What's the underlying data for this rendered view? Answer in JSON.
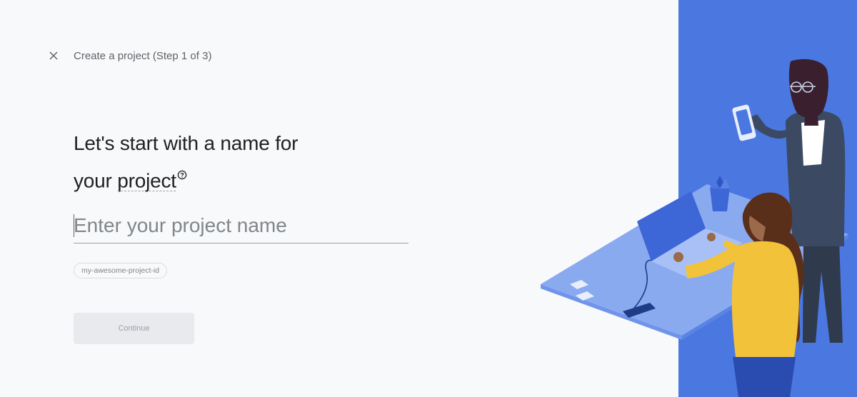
{
  "header": {
    "title": "Create a project (Step 1 of 3)",
    "close_icon": "close-icon"
  },
  "headline": {
    "line1": "Let's start with a name for",
    "line2_prefix": "your ",
    "line2_link": "project",
    "help_icon": "help-circle-icon"
  },
  "project_name": {
    "value": "",
    "placeholder": "Enter your project name"
  },
  "project_id_chip": "my-awesome-project-id",
  "continue_label": "Continue",
  "colors": {
    "panel_blue": "#4a77e0",
    "background": "#f8f9fa",
    "text_dark": "#202124",
    "text_muted": "#5f6368"
  }
}
